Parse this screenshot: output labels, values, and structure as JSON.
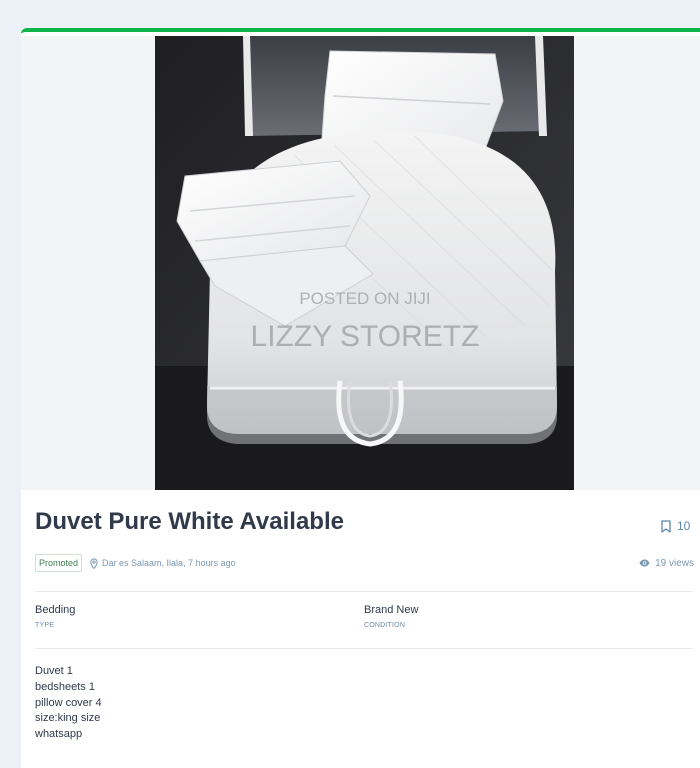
{
  "listing": {
    "title": "Duvet Pure White Available",
    "saved_count": "10",
    "promoted_label": "Promoted",
    "location": "Dar es Salaam, Ilala, 7 hours ago",
    "views": "19 views"
  },
  "photo": {
    "watermark_line1": "POSTED ON JIJI",
    "watermark_line2": "LIZZY STORETZ"
  },
  "attributes": [
    {
      "value": "Bedding",
      "label": "TYPE"
    },
    {
      "value": "Brand New",
      "label": "CONDITION"
    }
  ],
  "description_lines": [
    "Duvet 1",
    "bedsheets 1",
    "pillow cover 4",
    "size:king size",
    "whatsapp"
  ],
  "colors": {
    "accent": "#0fb44a",
    "title": "#303a4b",
    "muted": "#7a97b2"
  }
}
